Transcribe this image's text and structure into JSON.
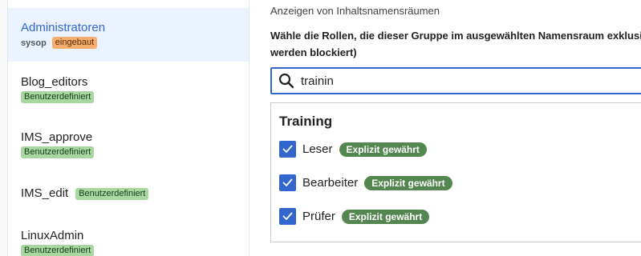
{
  "sidebar": {
    "groups": [
      {
        "name": "Administratoren",
        "sub_label": "sysop",
        "badge": "eingebaut"
      },
      {
        "name": "Blog_editors",
        "badge": "Benutzerdefiniert"
      },
      {
        "name": "IMS_approve",
        "badge": "Benutzerdefiniert"
      },
      {
        "name": "IMS_edit",
        "badge": "Benutzerdefiniert"
      },
      {
        "name": "LinuxAdmin",
        "badge": "Benutzerdefiniert"
      }
    ],
    "selected_index": 0
  },
  "main": {
    "namespace_label": "Anzeigen von Inhaltsnamensräumen",
    "instruction": "Wähle die Rollen, die dieser Gruppe im ausgewählten Namensraum exklusiv g werden blockiert)",
    "search": {
      "value": "trainin",
      "icon": "search-icon"
    },
    "results": {
      "title": "Training",
      "roles": [
        {
          "label": "Leser",
          "checked": true,
          "status": "Explizit gewährt"
        },
        {
          "label": "Bearbeiter",
          "checked": true,
          "status": "Explizit gewährt"
        },
        {
          "label": "Prüfer",
          "checked": true,
          "status": "Explizit gewährt"
        }
      ]
    }
  },
  "colors": {
    "accent": "#3366cc",
    "selected_bg": "#eaf3ff",
    "badge_custom": "#a8d7a0",
    "badge_builtin": "#f6ae6e",
    "badge_granted": "#54874f"
  }
}
